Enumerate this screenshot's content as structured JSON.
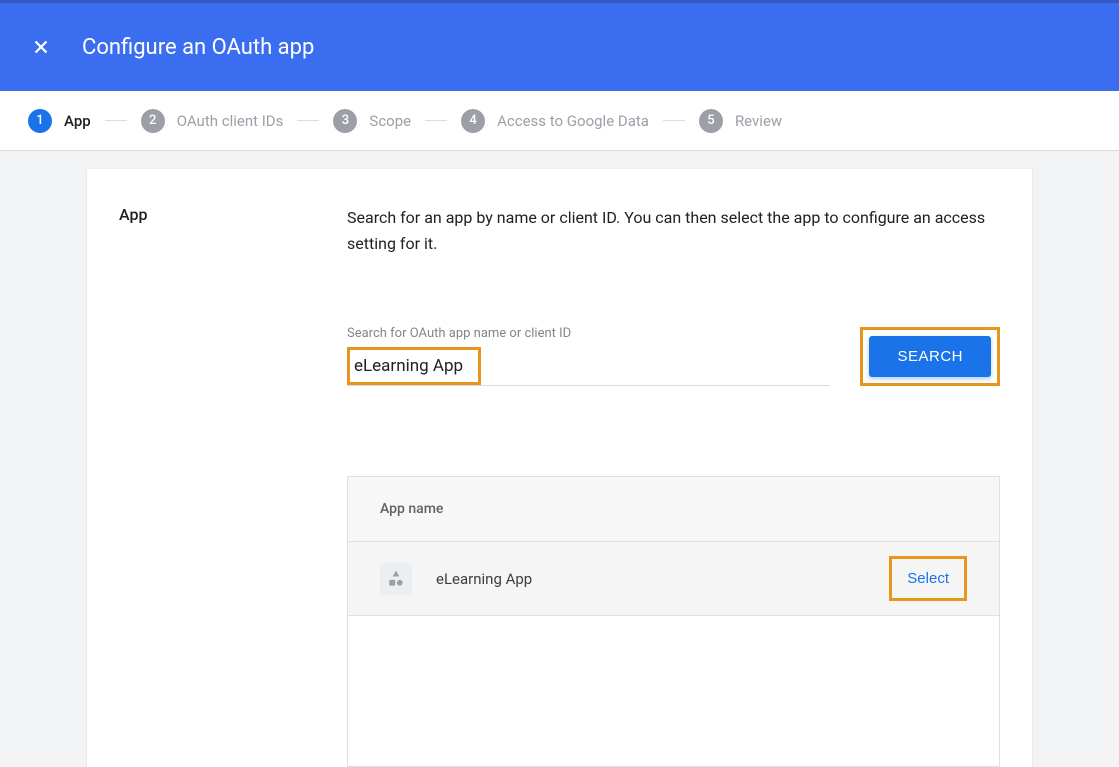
{
  "header": {
    "title": "Configure an OAuth app"
  },
  "stepper": {
    "steps": [
      {
        "num": "1",
        "label": "App",
        "active": true
      },
      {
        "num": "2",
        "label": "OAuth client IDs",
        "active": false
      },
      {
        "num": "3",
        "label": "Scope",
        "active": false
      },
      {
        "num": "4",
        "label": "Access to Google Data",
        "active": false
      },
      {
        "num": "5",
        "label": "Review",
        "active": false
      }
    ]
  },
  "main": {
    "section_title": "App",
    "description": "Search for an app by name or client ID. You can then select the app to configure an access setting for it.",
    "search_label": "Search for OAuth app name or client ID",
    "search_value": "eLearning App",
    "search_button": "SEARCH",
    "results": {
      "header": "App name",
      "rows": [
        {
          "name": "eLearning App",
          "select_label": "Select"
        }
      ]
    }
  }
}
